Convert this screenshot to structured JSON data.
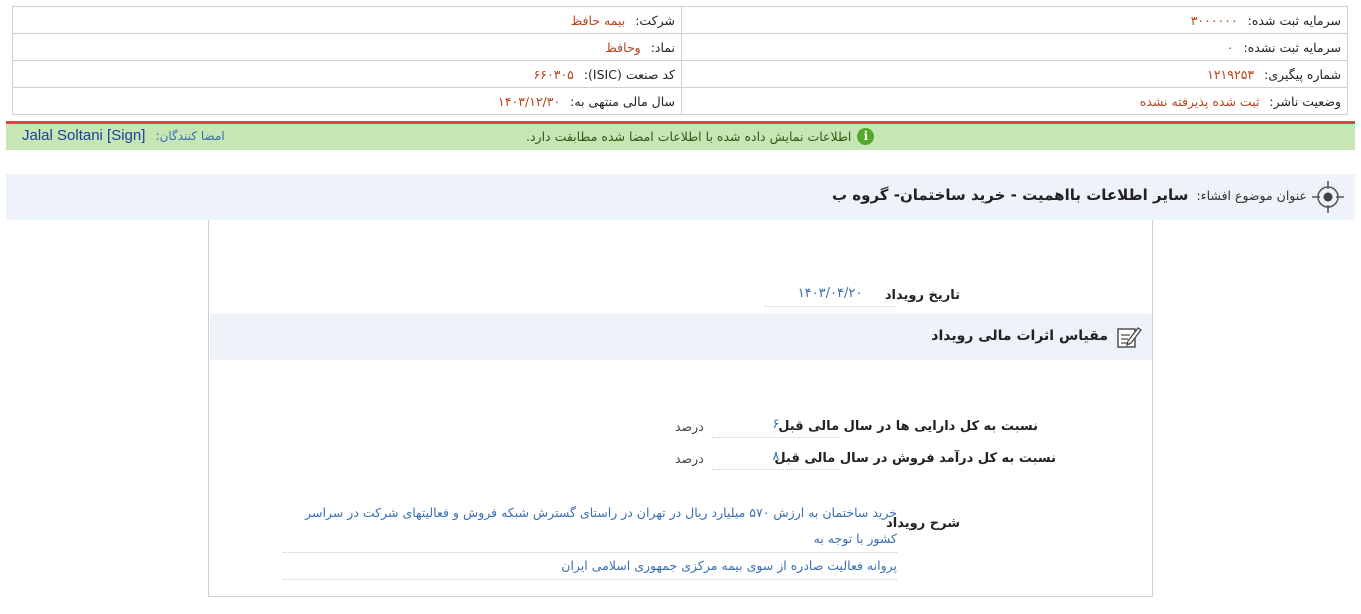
{
  "company_info": {
    "company_label": "شرکت:",
    "company_value": "بیمه حافظ",
    "registered_capital_label": "سرمایه ثبت شده:",
    "registered_capital_value": "۳۰۰۰۰۰۰",
    "symbol_label": "نماد:",
    "symbol_value": "وحافظ",
    "unregistered_capital_label": "سرمایه ثبت نشده:",
    "unregistered_capital_value": "۰",
    "isic_label": "کد صنعت (ISIC):",
    "isic_value": "۶۶۰۳۰۵",
    "tracking_label": "شماره پیگیری:",
    "tracking_value": "۱۲۱۹۲۵۳",
    "fiscal_year_label": "سال مالی منتهی به:",
    "fiscal_year_value": "۱۴۰۳/۱۲/۳۰",
    "publisher_status_label": "وضعیت ناشر:",
    "publisher_status_value": "ثبت شده پذیرفته نشده"
  },
  "signature_bar": {
    "signers_label": "امضا کنندگان:",
    "signer_name": "Jalal Soltani [Sign]",
    "message": "اطلاعات نمایش داده شده با اطلاعات امضا شده مطابقت دارد.",
    "info_icon": "i"
  },
  "subject": {
    "label": "عنوان موضوع افشاء:",
    "title": "سایر اطلاعات بااهمیت - خرید ساختمان- گروه ب"
  },
  "event": {
    "date_label": "تاریخ رویداد",
    "date_value": "۱۴۰۳/۰۴/۲۰",
    "section_title": "مقیاس اثرات مالی رویداد",
    "assets_ratio_label": "نسبت به کل دارایی ها در سال مالی قبل",
    "assets_ratio_value": "۶",
    "assets_ratio_unit": "درصد",
    "sales_ratio_label": "نسبت به کل درآمد فروش در سال مالی قبل",
    "sales_ratio_value": "۸",
    "sales_ratio_unit": "درصد",
    "description_label": "شرح رویداد",
    "description_line1": "خرید ساختمان به ارزش ۵۷۰ میلیارد ریال در تهران در راستای گسترش شبکه فروش و فعالیتهای شرکت در سراسر کشور با توجه به",
    "description_line2": "پروانه فعالیت صادره از سوی بیمه مرکزی جمهوری اسلامی ایران"
  },
  "colors": {
    "value_orange": "#b5441b",
    "value_blue": "#3a6fb0",
    "signature_green": "#c7e6b6",
    "alert_red": "#e04545",
    "header_bg": "#eef3fa"
  },
  "icons": [
    "info-icon",
    "target-icon",
    "edit-note-icon"
  ]
}
